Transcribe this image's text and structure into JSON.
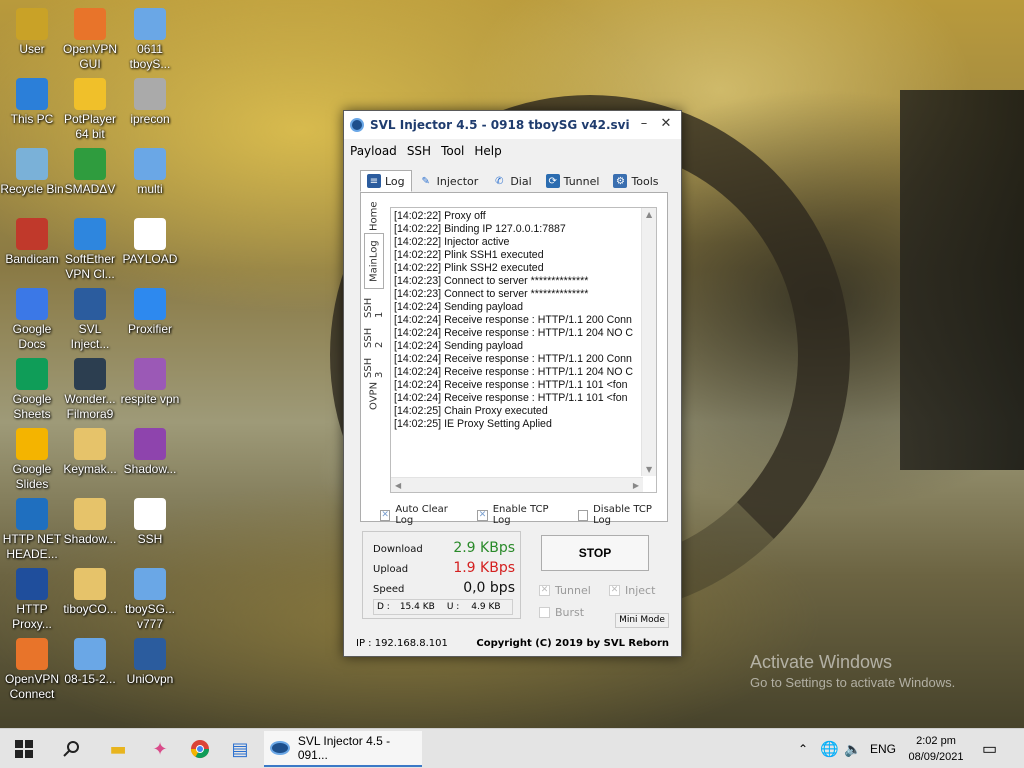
{
  "desktop": {
    "icons": [
      {
        "label": "User",
        "icon": "user-folder-icon"
      },
      {
        "label": "OpenVPN GUI",
        "icon": "openvpn-icon"
      },
      {
        "label": "0611 tboyS...",
        "icon": "config-file-icon"
      },
      {
        "label": "This PC",
        "icon": "computer-icon"
      },
      {
        "label": "PotPlayer 64 bit",
        "icon": "potplayer-icon"
      },
      {
        "label": "iprecon",
        "icon": "settings-file-icon"
      },
      {
        "label": "Recycle Bin",
        "icon": "recycle-bin-icon"
      },
      {
        "label": "SMADΔV",
        "icon": "smadav-icon"
      },
      {
        "label": "multi",
        "icon": "config-file-icon"
      },
      {
        "label": "Bandicam",
        "icon": "bandicam-icon"
      },
      {
        "label": "SoftEther VPN Cl...",
        "icon": "softether-icon"
      },
      {
        "label": "PAYLOAD",
        "icon": "text-file-icon"
      },
      {
        "label": "Google Docs",
        "icon": "google-docs-icon"
      },
      {
        "label": "SVL Inject...",
        "icon": "svl-injector-icon"
      },
      {
        "label": "Proxifier",
        "icon": "proxifier-icon"
      },
      {
        "label": "Google Sheets",
        "icon": "google-sheets-icon"
      },
      {
        "label": "Wonder... Filmora9",
        "icon": "filmora-icon"
      },
      {
        "label": "respite vpn",
        "icon": "respite-vpn-icon"
      },
      {
        "label": "Google Slides",
        "icon": "google-slides-icon"
      },
      {
        "label": "Keymak...",
        "icon": "folder-icon"
      },
      {
        "label": "Shadow...",
        "icon": "winrar-icon"
      },
      {
        "label": "HTTP NET HEADE...",
        "icon": "ssh-app-icon"
      },
      {
        "label": "Shadow...",
        "icon": "folder-icon"
      },
      {
        "label": "SSH",
        "icon": "text-file-icon"
      },
      {
        "label": "HTTP Proxy...",
        "icon": "http-proxy-icon"
      },
      {
        "label": "tiboyCO...",
        "icon": "folder-icon"
      },
      {
        "label": "tboySG... v777",
        "icon": "config-file-icon"
      },
      {
        "label": "OpenVPN Connect",
        "icon": "openvpn-icon"
      },
      {
        "label": "08-15-2...",
        "icon": "config-file-icon"
      },
      {
        "label": "UniOvpn",
        "icon": "uniovpn-icon"
      }
    ]
  },
  "window": {
    "title": "SVL Injector 4.5 - 0918 tboySG v42.svi",
    "minimize": "–",
    "close": "✕",
    "menu": [
      "Payload",
      "SSH",
      "Tool",
      "Help"
    ],
    "tabs": [
      {
        "label": "Log",
        "icon": "log-icon"
      },
      {
        "label": "Injector",
        "icon": "injector-icon"
      },
      {
        "label": "Dial",
        "icon": "phone-icon"
      },
      {
        "label": "Tunnel",
        "icon": "tunnel-icon"
      },
      {
        "label": "Tools",
        "icon": "tools-icon"
      }
    ],
    "side_tabs": [
      "Home",
      "MainLog",
      "SSH 1",
      "SSH 2",
      "SSH 3",
      "OVPN"
    ],
    "log_lines": [
      "[14:02:22] Proxy off",
      "[14:02:22] Binding IP 127.0.0.1:7887",
      "[14:02:22] Injector active",
      "[14:02:22] Plink SSH1 executed",
      "[14:02:22] Plink SSH2 executed",
      "[14:02:23] Connect to server **************",
      "[14:02:23] Connect to server **************",
      "[14:02:24] Sending payload",
      "[14:02:24] Receive response : HTTP/1.1 200 Conn",
      "[14:02:24] Receive response : HTTP/1.1 204 NO C",
      "[14:02:24] Sending payload",
      "[14:02:24] Receive response : HTTP/1.1 200 Conn",
      "[14:02:24] Receive response : HTTP/1.1 204 NO C",
      "[14:02:24] Receive response : HTTP/1.1 101 <fon",
      "[14:02:24] Receive response : HTTP/1.1 101 <fon",
      "[14:02:25] Chain Proxy executed",
      "[14:02:25] IE Proxy Setting Aplied"
    ],
    "checks": {
      "auto_clear": {
        "label": "Auto Clear Log",
        "checked": true
      },
      "enable_tcp": {
        "label": "Enable TCP Log",
        "checked": true
      },
      "disable_tcp": {
        "label": "Disable TCP Log",
        "checked": false
      }
    },
    "stats": {
      "download_label": "Download",
      "download_value": "2.9 KBps",
      "download_color": "#2a8a2a",
      "upload_label": "Upload",
      "upload_value": "1.9 KBps",
      "upload_color": "#d42020",
      "speed_label": "Speed",
      "speed_value": "0,0 bps",
      "d_label": "D :",
      "d_value": "15.4 KB",
      "u_label": "U :",
      "u_value": "4.9 KB"
    },
    "stop_button": "STOP",
    "options": {
      "tunnel": {
        "label": "Tunnel",
        "checked": true
      },
      "inject": {
        "label": "Inject",
        "checked": true
      },
      "burst": {
        "label": "Burst",
        "checked": false
      }
    },
    "mini_mode": "Mini Mode",
    "ip_text": "IP : 192.168.8.101",
    "copyright": "Copyright (C) 2019 by SVL Reborn"
  },
  "watermark": {
    "line1": "Activate Windows",
    "line2": "Go to Settings to activate Windows."
  },
  "taskbar": {
    "app_label": "SVL Injector 4.5 - 091...",
    "language": "ENG",
    "time": "2:02 pm",
    "date": "08/09/2021"
  }
}
